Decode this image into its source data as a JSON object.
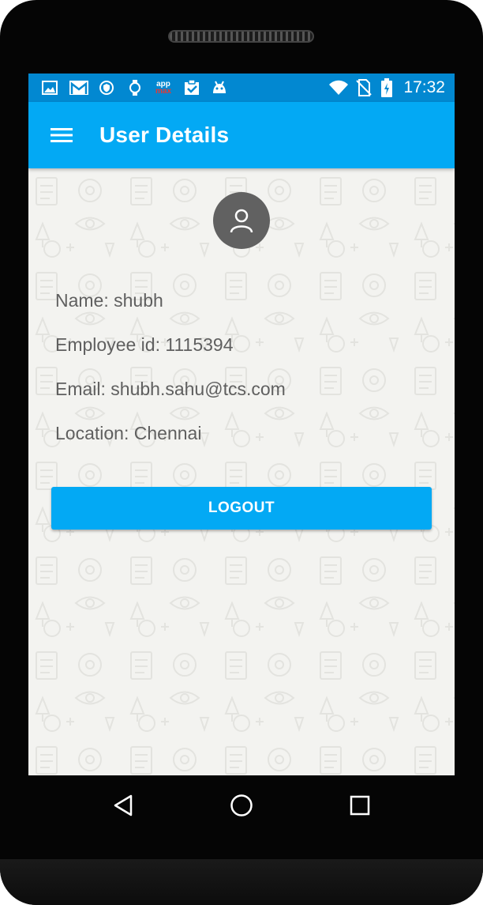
{
  "status_bar": {
    "time": "17:32",
    "left_icons": [
      "image-icon",
      "gmail-icon",
      "vpn-shield-icon",
      "watch-icon",
      "appmax-icon",
      "clipboard-check-icon",
      "android-icon"
    ],
    "right_icons": [
      "wifi-icon",
      "no-sim-icon",
      "battery-charging-icon"
    ],
    "appmax_text_top": "app",
    "appmax_text_bottom": "ma"
  },
  "app_bar": {
    "title": "User Details",
    "menu_icon": "hamburger-menu-icon"
  },
  "user": {
    "avatar_icon": "person-icon",
    "name_label": "Name: ",
    "name_value": "shubh",
    "employee_id_label": "Employee id: ",
    "employee_id_value": "1115394",
    "email_label": "Email: ",
    "email_value": "shubh.sahu@tcs.com",
    "location_label": "Location: ",
    "location_value": "Chennai"
  },
  "actions": {
    "logout_label": "LOGOUT"
  },
  "nav_bar": {
    "buttons": [
      "back-icon",
      "home-icon",
      "recents-icon"
    ]
  },
  "colors": {
    "status_bar": "#0288d1",
    "app_bar": "#03a9f4",
    "button": "#03a9f4",
    "avatar": "#616161",
    "background": "#f3f3f0",
    "text": "#5f5f5f"
  }
}
